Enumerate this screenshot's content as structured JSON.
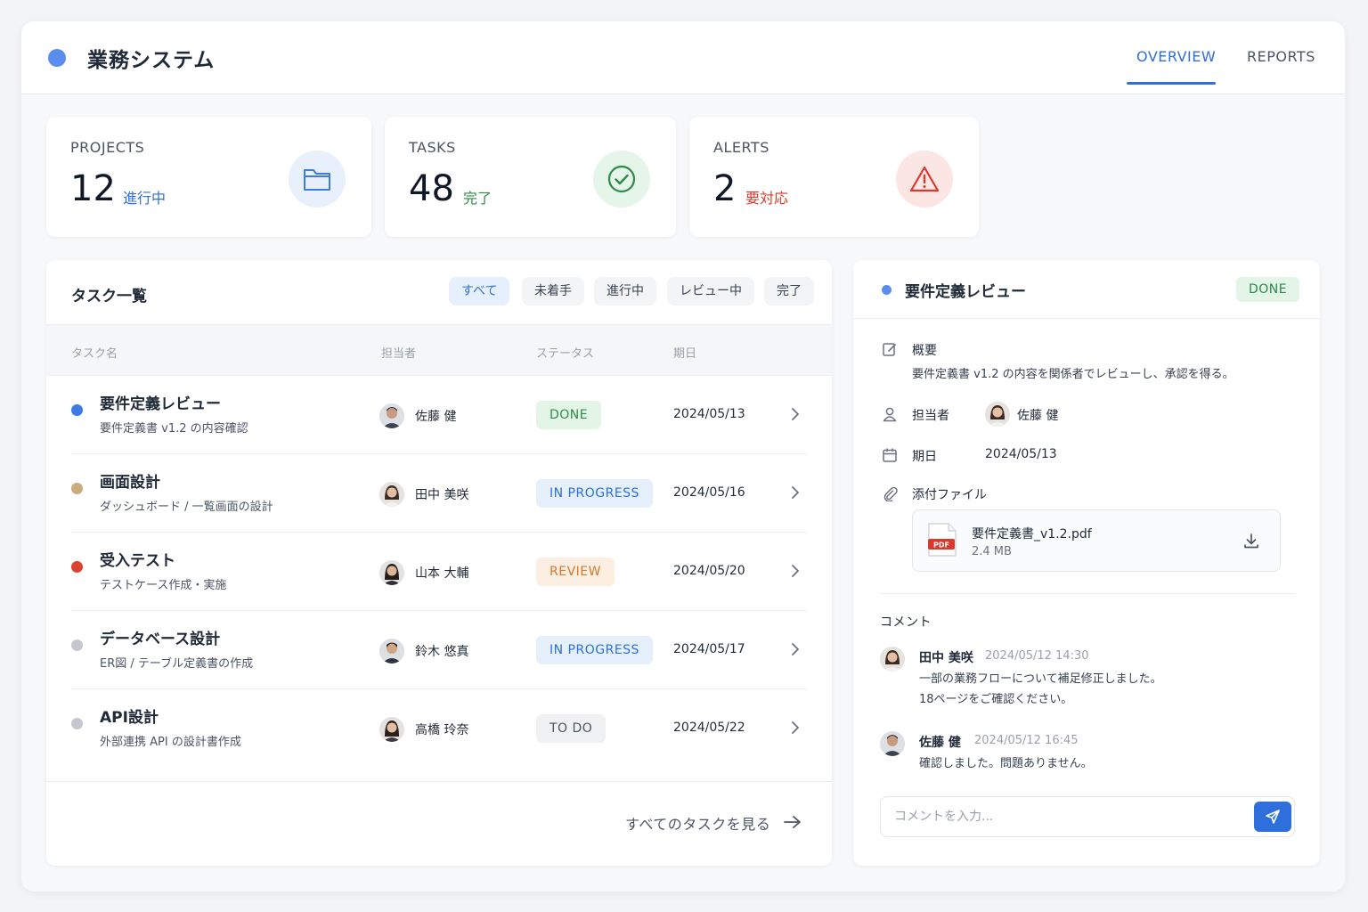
{
  "header": {
    "app_title": "業務システム",
    "tabs": [
      {
        "label": "OVERVIEW",
        "active": true
      },
      {
        "label": "REPORTS",
        "active": false
      }
    ],
    "accent_color": "#2f6fdc"
  },
  "stats": [
    {
      "label": "PROJECTS",
      "value": "12",
      "sub": "進行中",
      "sub_color": "#2f6fdc",
      "icon": "folder-icon"
    },
    {
      "label": "TASKS",
      "value": "48",
      "sub": "完了",
      "sub_color": "#2f8a4a",
      "icon": "check-circle-icon"
    },
    {
      "label": "ALERTS",
      "value": "2",
      "sub": "要対応",
      "sub_color": "#d93a2b",
      "icon": "warning-icon"
    }
  ],
  "task_list": {
    "title": "タスク一覧",
    "filters": [
      {
        "label": "すべて",
        "active": true
      },
      {
        "label": "未着手",
        "active": false
      },
      {
        "label": "進行中",
        "active": false
      },
      {
        "label": "レビュー中",
        "active": false
      },
      {
        "label": "完了",
        "active": false
      }
    ],
    "columns": [
      "タスク名",
      "担当者",
      "ステータス",
      "期日"
    ],
    "rows": [
      {
        "name": "要件定義レビュー",
        "desc": "要件定義書 v1.2 の内容確認",
        "assignee": "佐藤 健",
        "status": "DONE",
        "date": "2024/05/13",
        "dot_color": "#3b7be3"
      },
      {
        "name": "画面設計",
        "desc": "ダッシュボード / 一覧画面の設計",
        "assignee": "田中 美咲",
        "status": "IN PROGRESS",
        "date": "2024/05/16",
        "dot_color": "#c9ab7e"
      },
      {
        "name": "受入テスト",
        "desc": "テストケース作成・実施",
        "assignee": "山本 大輔",
        "status": "REVIEW",
        "date": "2024/05/20",
        "dot_color": "#d9432f"
      },
      {
        "name": "データベース設計",
        "desc": "ER図 / テーブル定義書の作成",
        "assignee": "鈴木 悠真",
        "status": "IN PROGRESS",
        "date": "2024/05/17",
        "dot_color": "#c4c7cd"
      },
      {
        "name": "API設計",
        "desc": "外部連携 API の設計書作成",
        "assignee": "高橋 玲奈",
        "status": "TO DO",
        "date": "2024/05/22",
        "dot_color": "#c4c7cd"
      }
    ],
    "see_all": "すべてのタスクを見る"
  },
  "detail": {
    "title": "要件定義レビュー",
    "status": "DONE",
    "summary_label": "概要",
    "summary_text": "要件定義書 v1.2 の内容を関係者でレビューし、承認を得る。",
    "assignee_label": "担当者",
    "assignee": "佐藤 健",
    "due_label": "期日",
    "due": "2024/05/13",
    "attachment_label": "添付ファイル",
    "file_name": "要件定義書_v1.2.pdf",
    "file_size": "2.4 MB",
    "file_type": "PDF",
    "comments_label": "コメント",
    "comments": [
      {
        "author": "田中 美咲",
        "time": "2024/05/12 14:30",
        "line1": "一部の業務フローについて補足修正しました。",
        "line2": "18ページをご確認ください。"
      },
      {
        "author": "佐藤 健",
        "time": "2024/05/12 16:45",
        "line1": "確認しました。問題ありません。",
        "line2": ""
      }
    ],
    "comment_placeholder": "コメントを入力..."
  }
}
